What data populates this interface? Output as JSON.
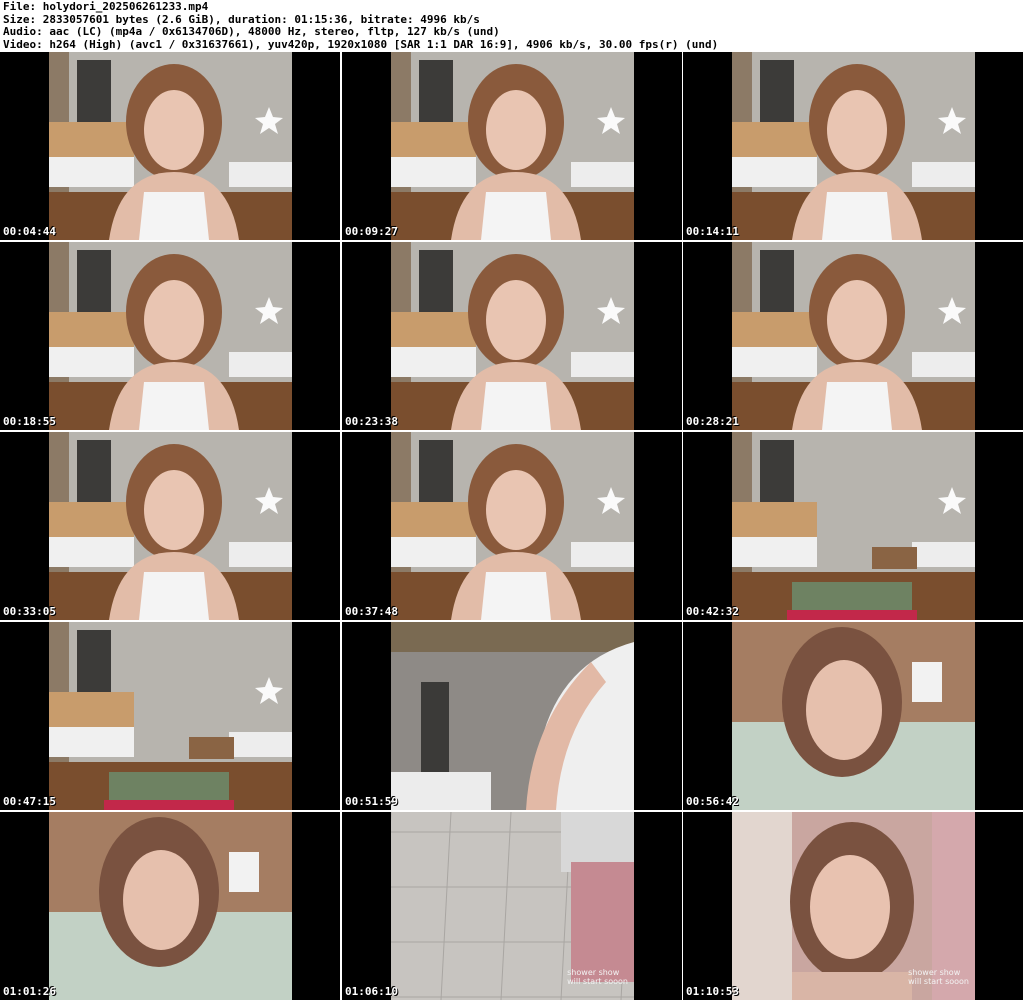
{
  "header": {
    "file": "File: holydori_202506261233.mp4",
    "size": "Size: 2833057601 bytes (2.6 GiB), duration: 01:15:36, bitrate: 4996 kb/s",
    "audio": "Audio: aac (LC) (mp4a / 0x6134706D), 48000 Hz, stereo, fltp, 127 kb/s (und)",
    "video": "Video: h264 (High) (avc1 / 0x31637661), yuv420p, 1920x1080 [SAR 1:1 DAR 16:9], 4906 kb/s, 30.00 fps(r) (und)"
  },
  "thumbnails": [
    {
      "time": "00:04:44",
      "scene": "room"
    },
    {
      "time": "00:09:27",
      "scene": "room"
    },
    {
      "time": "00:14:11",
      "scene": "room"
    },
    {
      "time": "00:18:55",
      "scene": "room"
    },
    {
      "time": "00:23:38",
      "scene": "room"
    },
    {
      "time": "00:28:21",
      "scene": "room"
    },
    {
      "time": "00:33:05",
      "scene": "room"
    },
    {
      "time": "00:37:48",
      "scene": "room"
    },
    {
      "time": "00:42:32",
      "scene": "room-empty"
    },
    {
      "time": "00:47:15",
      "scene": "room-empty"
    },
    {
      "time": "00:51:59",
      "scene": "room-arm"
    },
    {
      "time": "00:56:42",
      "scene": "bed"
    },
    {
      "time": "01:01:26",
      "scene": "bed"
    },
    {
      "time": "01:06:10",
      "scene": "bathroom",
      "overlay": "shower show\nwill start sooon"
    },
    {
      "time": "01:10:53",
      "scene": "pink",
      "overlay": "shower show\nwill start sooon"
    }
  ]
}
